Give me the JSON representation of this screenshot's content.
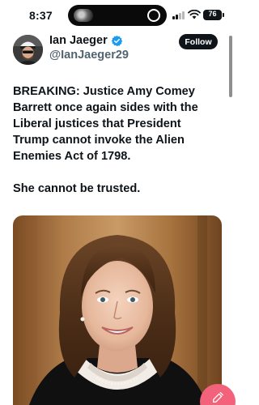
{
  "status_bar": {
    "time": "8:37",
    "battery": "76"
  },
  "author": {
    "display_name": "Ian Jaeger",
    "handle": "@IanJaeger29",
    "verified": true,
    "follow_label": "Follow"
  },
  "post": {
    "paragraphs": [
      {
        "lines": [
          "BREAKING: Justice Amy Comey",
          "Barrett once again sides with the",
          "Liberal justices that President",
          "Trump cannot invoke the Alien",
          "Enemies Act of 1798."
        ]
      },
      {
        "lines": [
          "She cannot be trusted."
        ]
      }
    ]
  },
  "icons": {
    "verified": "verified-badge-icon",
    "compose": "compose-icon",
    "wifi": "wifi-icon",
    "signal": "cellular-signal-icon",
    "battery": "battery-icon"
  },
  "colors": {
    "text": "#0f1419",
    "secondary_text": "#536471",
    "verified_blue": "#1d9bf0",
    "follow_bg": "#0f1419",
    "fab": "#f2637b"
  }
}
